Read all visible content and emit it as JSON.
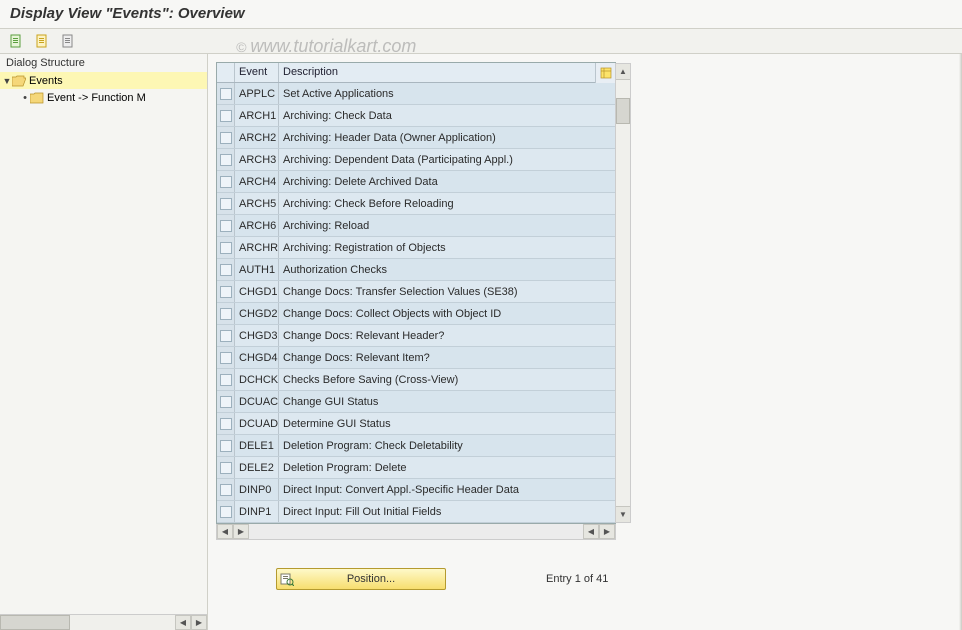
{
  "title": "Display View \"Events\": Overview",
  "watermark": "www.tutorialkart.com",
  "toolbar": {
    "btn1_name": "expand-all-icon",
    "btn2_name": "collapse-all-icon",
    "btn3_name": "layout-icon"
  },
  "tree": {
    "header": "Dialog Structure",
    "root": {
      "label": "Events",
      "expanded": true
    },
    "child": {
      "label": "Event -> Function M"
    }
  },
  "table": {
    "col_event": "Event",
    "col_desc": "Description",
    "rows": [
      {
        "event": "APPLC",
        "desc": "Set Active Applications"
      },
      {
        "event": "ARCH1",
        "desc": "Archiving: Check Data"
      },
      {
        "event": "ARCH2",
        "desc": "Archiving: Header Data (Owner Application)"
      },
      {
        "event": "ARCH3",
        "desc": "Archiving: Dependent Data (Participating Appl.)"
      },
      {
        "event": "ARCH4",
        "desc": "Archiving: Delete Archived Data"
      },
      {
        "event": "ARCH5",
        "desc": "Archiving: Check Before Reloading"
      },
      {
        "event": "ARCH6",
        "desc": "Archiving: Reload"
      },
      {
        "event": "ARCHR",
        "desc": "Archiving: Registration of Objects"
      },
      {
        "event": "AUTH1",
        "desc": "Authorization Checks"
      },
      {
        "event": "CHGD1",
        "desc": "Change Docs: Transfer Selection Values (SE38)"
      },
      {
        "event": "CHGD2",
        "desc": "Change Docs: Collect Objects with Object ID"
      },
      {
        "event": "CHGD3",
        "desc": "Change Docs: Relevant Header?"
      },
      {
        "event": "CHGD4",
        "desc": "Change Docs: Relevant Item?"
      },
      {
        "event": "DCHCK",
        "desc": "Checks Before Saving (Cross-View)"
      },
      {
        "event": "DCUAC",
        "desc": "Change GUI Status"
      },
      {
        "event": "DCUAD",
        "desc": "Determine GUI Status"
      },
      {
        "event": "DELE1",
        "desc": "Deletion Program: Check Deletability"
      },
      {
        "event": "DELE2",
        "desc": "Deletion Program: Delete"
      },
      {
        "event": "DINP0",
        "desc": "Direct Input: Convert Appl.-Specific Header Data"
      },
      {
        "event": "DINP1",
        "desc": "Direct Input: Fill Out Initial Fields"
      }
    ]
  },
  "footer": {
    "position_label": "Position...",
    "entry_text": "Entry 1 of 41"
  }
}
